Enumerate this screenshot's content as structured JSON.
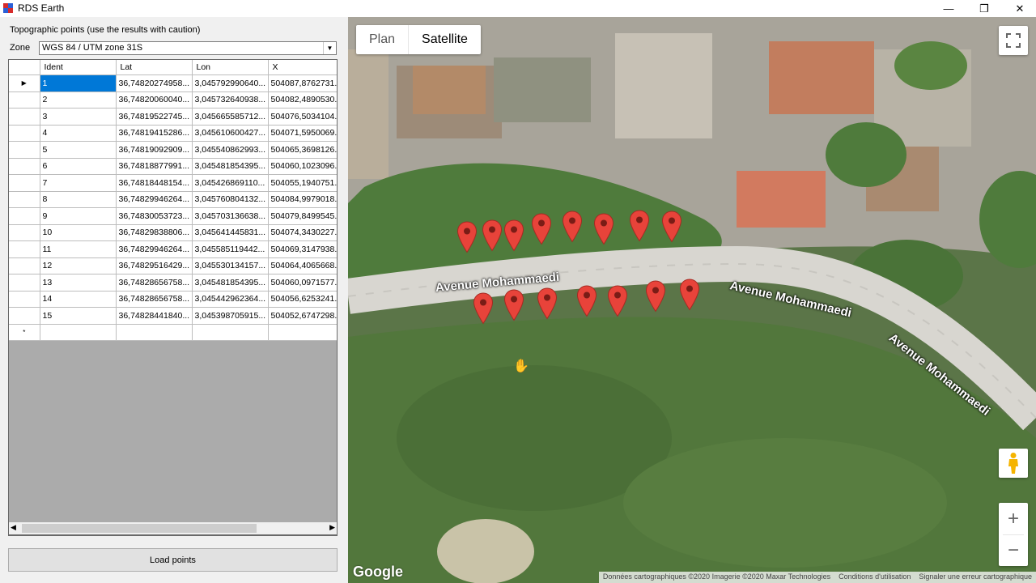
{
  "window": {
    "title": "RDS Earth",
    "controls": {
      "minimize": "—",
      "maximize": "❐",
      "close": "✕"
    }
  },
  "panel": {
    "label": "Topographic points (use the results with caution)",
    "zone_label": "Zone",
    "zone_value": "WGS 84 / UTM zone 31S",
    "load_button": "Load points"
  },
  "grid": {
    "columns": [
      "Ident",
      "Lat",
      "Lon",
      "X"
    ],
    "rows": [
      {
        "ident": "1",
        "lat": "36,74820274958...",
        "lon": "3,045792990640...",
        "x": "504087,8762731..."
      },
      {
        "ident": "2",
        "lat": "36,74820060040...",
        "lon": "3,045732640938...",
        "x": "504082,4890530..."
      },
      {
        "ident": "3",
        "lat": "36,74819522745...",
        "lon": "3,045665585712...",
        "x": "504076,5034104..."
      },
      {
        "ident": "4",
        "lat": "36,74819415286...",
        "lon": "3,045610600427...",
        "x": "504071,5950069..."
      },
      {
        "ident": "5",
        "lat": "36,74819092909...",
        "lon": "3,045540862993...",
        "x": "504065,3698126..."
      },
      {
        "ident": "6",
        "lat": "36,74818877991...",
        "lon": "3,045481854395...",
        "x": "504060,1023096..."
      },
      {
        "ident": "7",
        "lat": "36,74818448154...",
        "lon": "3,045426869110...",
        "x": "504055,1940751..."
      },
      {
        "ident": "8",
        "lat": "36,74829946264...",
        "lon": "3,045760804132...",
        "x": "504084,9979018..."
      },
      {
        "ident": "9",
        "lat": "36,74830053723...",
        "lon": "3,045703136638...",
        "x": "504079,8499545..."
      },
      {
        "ident": "10",
        "lat": "36,74829838806...",
        "lon": "3,045641445831...",
        "x": "504074,3430227..."
      },
      {
        "ident": "11",
        "lat": "36,74829946264...",
        "lon": "3,045585119442...",
        "x": "504069,3147938..."
      },
      {
        "ident": "12",
        "lat": "36,74829516429...",
        "lon": "3,045530134157...",
        "x": "504064,4065668..."
      },
      {
        "ident": "13",
        "lat": "36,74828656758...",
        "lon": "3,045481854395...",
        "x": "504060,0971577..."
      },
      {
        "ident": "14",
        "lat": "36,74828656758...",
        "lon": "3,045442962364...",
        "x": "504056,6253241..."
      },
      {
        "ident": "15",
        "lat": "36,74828441840...",
        "lon": "3,045398705915...",
        "x": "504052,6747298..."
      }
    ],
    "selected_row_marker": "▶",
    "new_row_marker": "*"
  },
  "map": {
    "type_plan": "Plan",
    "type_satellite": "Satellite",
    "road_label": "Avenue Mohammaedi",
    "google": "Google",
    "attribution": [
      "Données cartographiques ©2020 Imagerie ©2020 Maxar Technologies",
      "Conditions d'utilisation",
      "Signaler une erreur cartographique"
    ],
    "zoom_in": "+",
    "zoom_out": "−",
    "marker_color": "#e8433a",
    "icons": {
      "fullscreen": "fullscreen-icon",
      "pegman": "pegman-icon",
      "marker": "map-marker-icon",
      "cursor": "hand-cursor-icon"
    }
  }
}
